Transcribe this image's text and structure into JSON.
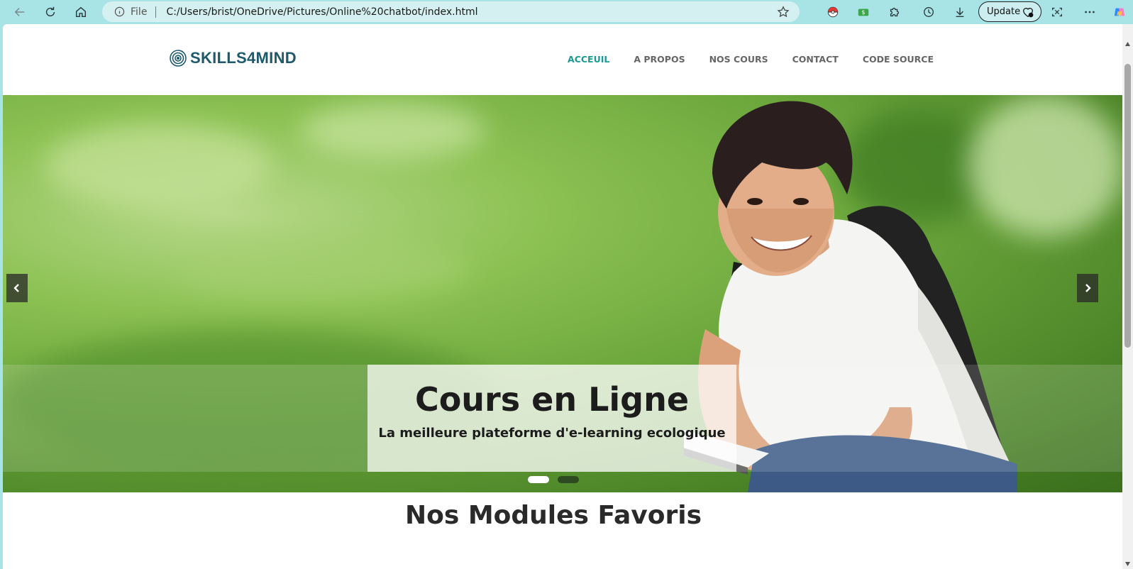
{
  "browser": {
    "address": {
      "scheme_label": "File",
      "url": "C:/Users/brist/OneDrive/Pictures/Online%20chatbot/index.html"
    },
    "update_label": "Update",
    "nav_icons": [
      "back-arrow-icon",
      "refresh-icon",
      "home-icon"
    ],
    "extension_icons": [
      "pokeball-extension-icon",
      "money-extension-icon",
      "puzzle-extensions-icon",
      "history-icon",
      "download-icon",
      "screenshot-icon",
      "more-icon",
      "copilot-icon"
    ]
  },
  "site": {
    "logo_text": "SKILLS4MIND",
    "nav": [
      {
        "label": "ACCEUIL",
        "active": true
      },
      {
        "label": "A PROPOS",
        "active": false
      },
      {
        "label": "NOS COURS",
        "active": false
      },
      {
        "label": "CONTACT",
        "active": false
      },
      {
        "label": "CODE SOURCE",
        "active": false
      }
    ],
    "colors": {
      "brand": "#1e5a6e",
      "nav_active": "#1a9a92",
      "nav_default": "#666666",
      "chrome": "#a8e3e6"
    }
  },
  "hero": {
    "title": "Cours en Ligne",
    "subtitle": "La meilleure plateforme d'e-learning ecologique",
    "slide_count": 2,
    "active_slide": 1
  },
  "section": {
    "title": "Nos Modules Favoris"
  }
}
